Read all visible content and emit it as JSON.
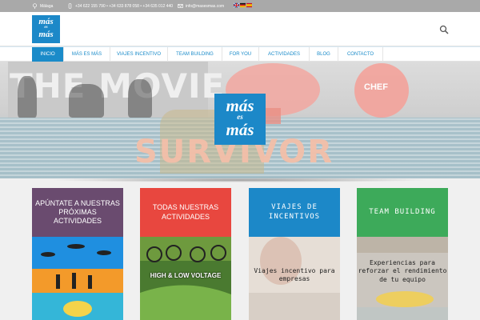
{
  "topbar": {
    "location": "Málaga",
    "phones": "+34 622 155 790 • +34 633 878 058 • +34 635 012 440",
    "email": "info@masesmas.com",
    "languages": [
      "en",
      "de",
      "es"
    ]
  },
  "logo": {
    "line1": "más",
    "line2": "es",
    "line3": "más"
  },
  "nav": {
    "items": [
      {
        "label": "INICIO",
        "active": true
      },
      {
        "label": "MÁS ES MÁS",
        "active": false
      },
      {
        "label": "VIAJES INCENTIVO",
        "active": false
      },
      {
        "label": "TEAM BUILDING",
        "active": false
      },
      {
        "label": "FOR YOU",
        "active": false
      },
      {
        "label": "ACTIVIDADES",
        "active": false
      },
      {
        "label": "BLOG",
        "active": false
      },
      {
        "label": "CONTACTO",
        "active": false
      }
    ]
  },
  "hero": {
    "movie_text": "THE MOVIE",
    "chef_text": "CHEF",
    "survivor_text": "SURVIVOR",
    "logo": {
      "line1": "más",
      "line2": "es",
      "line3": "más"
    }
  },
  "cards": [
    {
      "title": "APÚNTATE A NUESTRAS PRÓXIMAS ACTIVIDADES",
      "body": "",
      "color": "#6a4b6f"
    },
    {
      "title": "TODAS NUESTRAS ACTIVIDADES",
      "body": "HIGH & LOW VOLTAGE",
      "color": "#e8473f"
    },
    {
      "title": "VIAJES DE INCENTIVOS",
      "body": "Viajes incentivo para empresas",
      "color": "#1c88c8"
    },
    {
      "title": "TEAM BUILDING",
      "body": "Experiencias para reforzar el rendimiento de tu equipo",
      "color": "#3daa5a"
    }
  ],
  "colors": {
    "accent": "#1a8bc9",
    "topbar": "#a9a9a9"
  }
}
